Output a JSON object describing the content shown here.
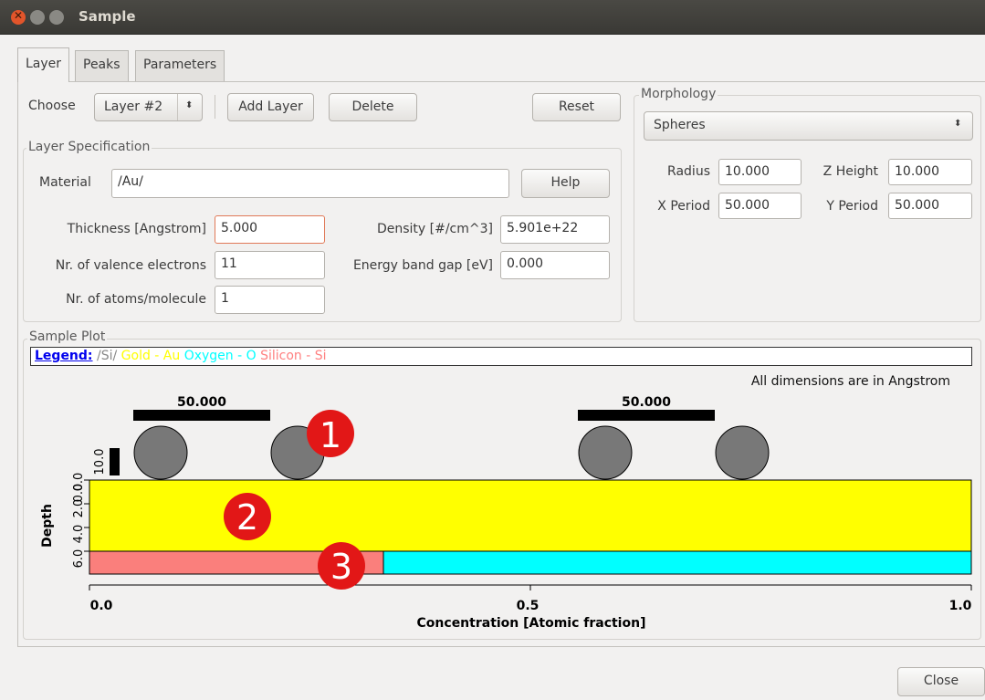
{
  "window": {
    "title": "Sample"
  },
  "tabs": [
    {
      "label": "Layer",
      "active": true
    },
    {
      "label": "Peaks",
      "active": false
    },
    {
      "label": "Parameters",
      "active": false
    }
  ],
  "layer": {
    "choose_label": "Choose",
    "layer_select": "Layer #2",
    "add_label": "Add Layer",
    "delete_label": "Delete",
    "reset_label": "Reset"
  },
  "spec": {
    "group_label": "Layer Specification",
    "material_label": "Material",
    "material_value": "/Au/",
    "help_label": "Help",
    "thickness_label": "Thickness [Angstrom]",
    "thickness_value": "5.000",
    "density_label": "Density [#/cm^3]",
    "density_value": "5.901e+22",
    "valence_label": "Nr. of valence electrons",
    "valence_value": "11",
    "bandgap_label": "Energy band gap [eV]",
    "bandgap_value": "0.000",
    "atoms_label": "Nr. of atoms/molecule",
    "atoms_value": "1"
  },
  "morphology": {
    "group_label": "Morphology",
    "type": "Spheres",
    "radius_label": "Radius",
    "radius_value": "10.000",
    "zheight_label": "Z Height",
    "zheight_value": "10.000",
    "xperiod_label": "X Period",
    "xperiod_value": "50.000",
    "yperiod_label": "Y Period",
    "yperiod_value": "50.000"
  },
  "plot": {
    "group_label": "Sample Plot",
    "legend_title": "Legend:",
    "legend_items": [
      {
        "text": "/Si/",
        "color": "#888888"
      },
      {
        "text": "Gold - Au",
        "color": "#ffff00"
      },
      {
        "text": "Oxygen - O",
        "color": "#00ffff"
      },
      {
        "text": "Silicon - Si",
        "color": "#ff8080"
      }
    ],
    "dimensions_note": "All dimensions are in Angstrom",
    "period_label_1": "50.000",
    "period_label_2": "50.000",
    "height_label": "10.0",
    "depth_label": "Depth",
    "depth_ticks": [
      "0.0",
      "2.0",
      "4.0",
      "6.0",
      "0.0"
    ],
    "x_ticks": [
      "0.0",
      "0.5",
      "1.0"
    ],
    "x_label": "Concentration [Atomic fraction]",
    "annotations": [
      "1",
      "2",
      "3"
    ],
    "colors": {
      "gold": "#ffff00",
      "silicon": "#fa7f7c",
      "oxygen": "#00ffff",
      "sphere": "#787878",
      "annotation": "#e21717"
    }
  },
  "close_label": "Close"
}
